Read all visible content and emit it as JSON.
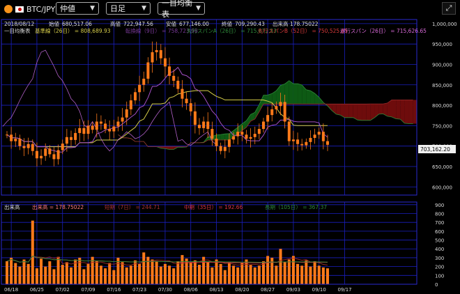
{
  "toolbar": {
    "pair_label": "BTC/JPY",
    "price_type": "仲値",
    "timeframe": "日足",
    "indicator": "一目均衡表",
    "expand_icon": "expand-icon"
  },
  "info": {
    "date": "2018/08/12",
    "open_label": "始値",
    "open": "680,517.06",
    "high_label": "高値",
    "high": "722,947.56",
    "low_label": "安値",
    "low": "677,146.00",
    "close_label": "終値",
    "close": "709,290.43",
    "volume_label": "出来高",
    "volume": "178.75022"
  },
  "ichimoku_legend": {
    "title": "一目均衡表",
    "kijun": "基準線（26日） = 808,689.93",
    "tenkan": "転換線（9日） = 758,723.98",
    "senkouA": "先行スパンA（26日） = 715,672.53",
    "senkouB": "先行スパンB（52日） = 750,525.65",
    "chikou": "遅行スパン（26日） = 715,626.65"
  },
  "current_price": "703,162.20",
  "volume_legend": {
    "title": "出来高",
    "vol": "出来高 = 178.75022",
    "short": "短期（7日） = 244.71",
    "mid": "中期（35日） = 192.66",
    "long": "長期（105日） = 367.37"
  },
  "colors": {
    "grid": "#1a1fbf",
    "candle": "#ff7a1a",
    "kijun": "#d8cf4a",
    "tenkan": "#a34fc4",
    "cloud_bear": "#6e0c0c",
    "cloud_bull": "#0d5a14",
    "volume": "#ff7a1a"
  },
  "chart_data": [
    {
      "type": "candlestick",
      "y_ticks": [
        "1,000,000",
        "950,000",
        "900,000",
        "850,000",
        "800,000",
        "750,000",
        "700,000",
        "650,000",
        "600,000"
      ],
      "ylim": [
        580000,
        1010000
      ],
      "x_ticks": [
        "06/18",
        "06/25",
        "07/02",
        "07/09",
        "07/16",
        "07/23",
        "07/30",
        "08/06",
        "08/13",
        "08/20",
        "08/27",
        "09/03",
        "09/10",
        "09/17"
      ],
      "close": [
        728000,
        712000,
        718000,
        700000,
        695000,
        705000,
        688000,
        670000,
        676000,
        694000,
        680000,
        668000,
        690000,
        706000,
        722000,
        715000,
        732000,
        744000,
        730000,
        750000,
        740000,
        760000,
        755000,
        742000,
        736000,
        748000,
        760000,
        770000,
        790000,
        812000,
        832000,
        850000,
        865000,
        905000,
        930000,
        935000,
        915000,
        895000,
        872000,
        860000,
        840000,
        816000,
        805000,
        785000,
        752000,
        744000,
        760000,
        742000,
        718000,
        700000,
        688000,
        698000,
        716000,
        724000,
        735000,
        728000,
        718000,
        722000,
        730000,
        742000,
        760000,
        776000,
        790000,
        798000,
        808000,
        760000,
        712000,
        716000,
        705000,
        702000,
        710000,
        720000,
        728000,
        735000,
        712000,
        703162
      ]
    },
    {
      "type": "bar",
      "title": "出来高",
      "y_ticks": [
        "900",
        "800",
        "700",
        "600",
        "500",
        "400",
        "300",
        "200",
        "100",
        "0"
      ],
      "ylim": [
        0,
        930
      ],
      "x_ticks": [
        "06/18",
        "06/25",
        "07/02",
        "07/09",
        "07/16",
        "07/23",
        "07/30",
        "08/06",
        "08/13",
        "08/20",
        "08/27",
        "09/03",
        "09/10",
        "09/17"
      ],
      "values": [
        260,
        300,
        240,
        200,
        280,
        230,
        720,
        180,
        290,
        200,
        260,
        170,
        310,
        220,
        250,
        190,
        280,
        300,
        170,
        230,
        310,
        260,
        210,
        180,
        240,
        160,
        300,
        250,
        190,
        210,
        270,
        230,
        360,
        310,
        280,
        260,
        200,
        230,
        210,
        180,
        260,
        330,
        290,
        240,
        270,
        220,
        310,
        260,
        190,
        280,
        230,
        160,
        250,
        210,
        190,
        240,
        280,
        220,
        190,
        210,
        260,
        320,
        300,
        210,
        400,
        250,
        280,
        320,
        230,
        210,
        270,
        200,
        260,
        210,
        190,
        180
      ]
    }
  ]
}
